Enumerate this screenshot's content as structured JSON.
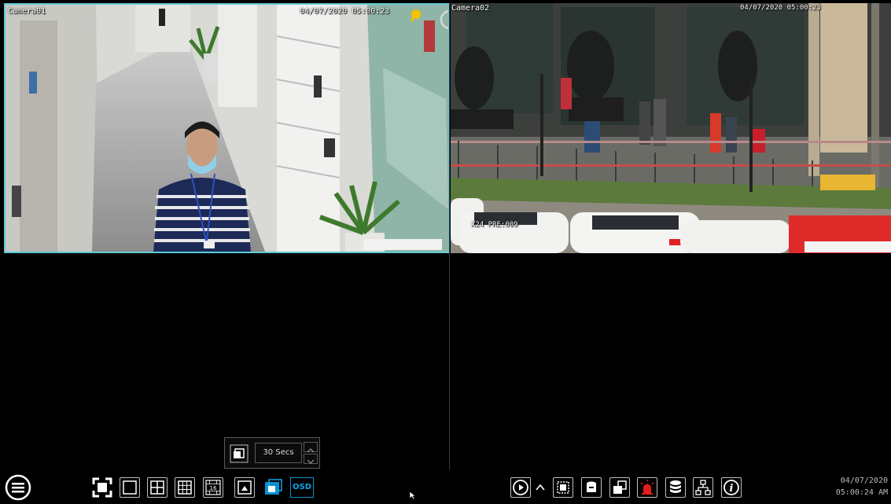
{
  "cameras": [
    {
      "name": "Camera01",
      "timestamp": "04/07/2020 05:00:23"
    },
    {
      "name": "Camera02",
      "timestamp": "04/07/2020 05:00:23"
    }
  ],
  "camera2_osd_overlay": "X24 PRE:009",
  "popup": {
    "interval_value": "30 Secs"
  },
  "taskbar": {
    "osd_label": "OSD",
    "date": "04/07/2020",
    "time": "05:00:24 AM"
  },
  "colors": {
    "selection_border": "#5fc9d6",
    "accent": "#0aa6e8",
    "alarm": "#e21b1b"
  }
}
